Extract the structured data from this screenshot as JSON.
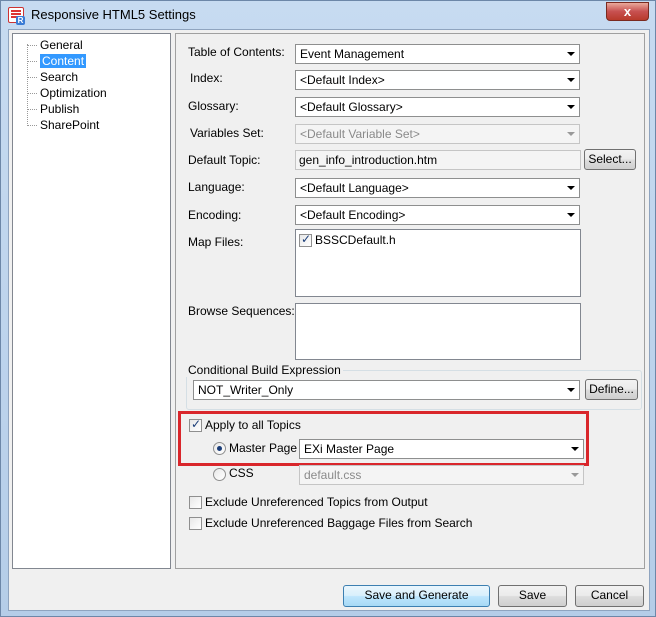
{
  "window": {
    "title": "Responsive HTML5 Settings",
    "close_glyph": "x"
  },
  "tree": {
    "items": [
      {
        "label": "General"
      },
      {
        "label": "Content",
        "selected": true
      },
      {
        "label": "Search"
      },
      {
        "label": "Optimization"
      },
      {
        "label": "Publish"
      },
      {
        "label": "SharePoint"
      }
    ]
  },
  "content": {
    "toc": {
      "label": "Table of Contents:",
      "value": "Event Management"
    },
    "index": {
      "label": "Index:",
      "value": "<Default Index>"
    },
    "glossary": {
      "label": "Glossary:",
      "value": "<Default Glossary>"
    },
    "variables": {
      "label": "Variables Set:",
      "value": "<Default Variable Set>"
    },
    "default_topic": {
      "label": "Default Topic:",
      "value": "gen_info_introduction.htm",
      "button": "Select..."
    },
    "language": {
      "label": "Language:",
      "value": "<Default Language>"
    },
    "encoding": {
      "label": "Encoding:",
      "value": "<Default Encoding>"
    },
    "map_files": {
      "label": "Map Files:",
      "items": [
        {
          "label": "BSSCDefault.h",
          "checked": true
        }
      ]
    },
    "browse_sequences": {
      "label": "Browse Sequences:"
    },
    "cbe": {
      "label": "Conditional Build Expression",
      "value": "NOT_Writer_Only",
      "button": "Define..."
    },
    "apply_all": {
      "label": "Apply to all Topics",
      "checked": true
    },
    "master_page": {
      "label": "Master Page",
      "value": "EXi Master Page",
      "selected": true
    },
    "css": {
      "label": "CSS",
      "value": "default.css",
      "selected": false
    },
    "exclude_topics": {
      "label": "Exclude Unreferenced Topics from Output",
      "checked": false
    },
    "exclude_baggage": {
      "label": "Exclude Unreferenced Baggage Files from Search",
      "checked": false
    }
  },
  "footer": {
    "save_generate": "Save and Generate",
    "save": "Save",
    "cancel": "Cancel"
  },
  "colors": {
    "highlight": "#d9262b",
    "selection": "#3399ff"
  }
}
